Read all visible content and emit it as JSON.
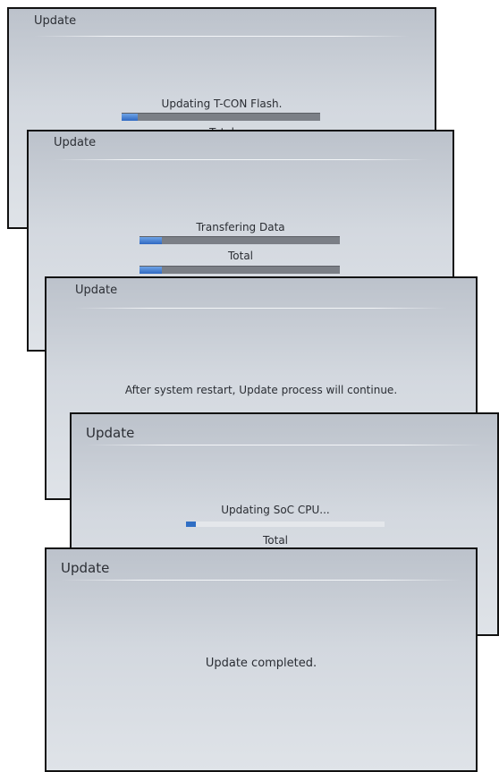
{
  "screens": [
    {
      "title": "Update",
      "message": "Updating T-CON Flash.",
      "total_label": "Total",
      "progress": 0.08
    },
    {
      "title": "Update",
      "message": "Transfering Data",
      "total_label": "Total",
      "progress": 0.11,
      "total_progress": 0.11
    },
    {
      "title": "Update",
      "message": "After system restart, Update process will continue."
    },
    {
      "title": "Update",
      "message": "Updating SoC CPU...",
      "total_label": "Total",
      "progress": 0.05
    },
    {
      "title": "Update",
      "message": "Update completed."
    }
  ],
  "colors": {
    "progress_fill": "#2f68c2",
    "bar_track": "#7b7f86"
  }
}
